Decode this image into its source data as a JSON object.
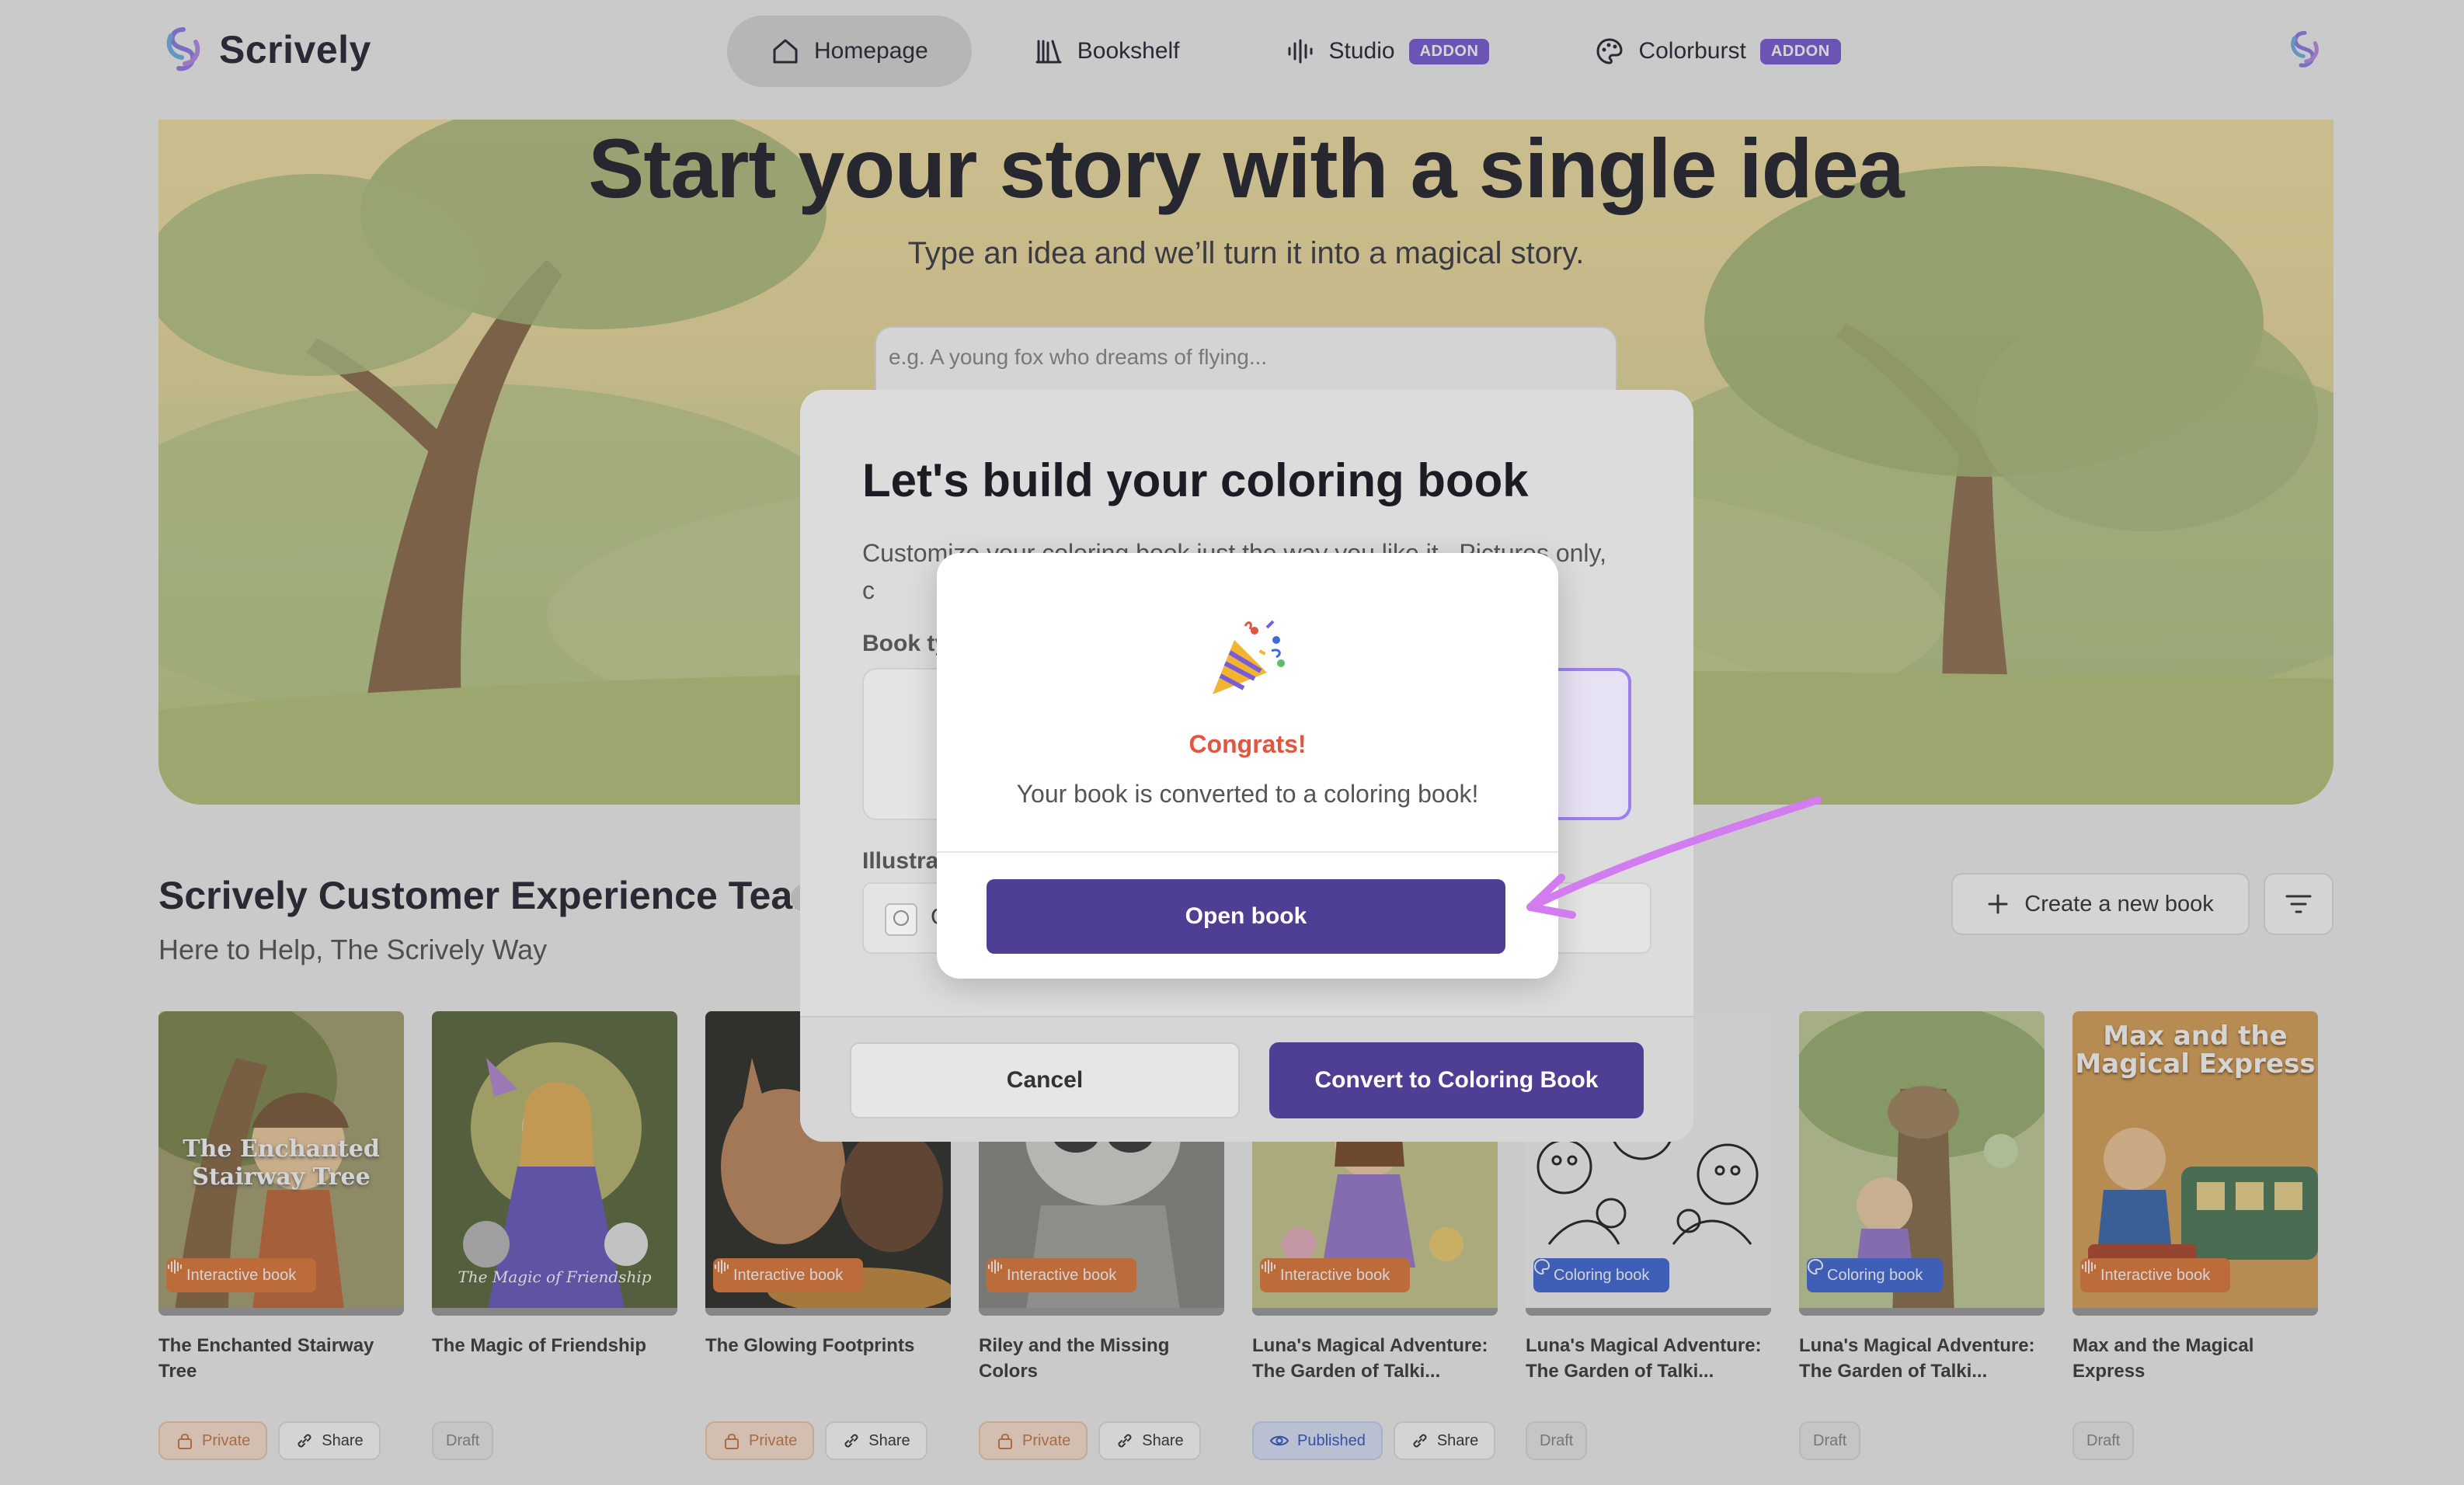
{
  "app": {
    "name": "Scrively"
  },
  "nav": {
    "items": [
      {
        "label": "Homepage",
        "icon": "home-icon",
        "active": true
      },
      {
        "label": "Bookshelf",
        "icon": "bookshelf-icon"
      },
      {
        "label": "Studio",
        "icon": "audio-wave-icon",
        "badge": "ADDON"
      },
      {
        "label": "Colorburst",
        "icon": "palette-icon",
        "badge": "ADDON"
      }
    ]
  },
  "hero": {
    "title": "Start your story with a single idea",
    "subtitle": "Type an idea and we’ll turn it into a magical story.",
    "input_placeholder": "e.g. A young fox who dreams of flying..."
  },
  "team": {
    "title": "Scrively Customer Experience Team",
    "subtitle": "Here to Help, The Scrively Way",
    "create_label": "Create a new book"
  },
  "books": [
    {
      "title": "The Enchanted Stairway Tree",
      "type": "Interactive book",
      "status": "Private",
      "share": "Share"
    },
    {
      "title": "The Magic of Friendship",
      "type": "",
      "status": "Draft"
    },
    {
      "title": "The Glowing Footprints",
      "type": "Interactive book",
      "status": "Private",
      "share": "Share"
    },
    {
      "title": "Riley and the Missing Colors",
      "type": "Interactive book",
      "status": "Private",
      "share": "Share"
    },
    {
      "title": "Luna's Magical Adventure: The Garden of Talki...",
      "type": "Interactive book",
      "status": "Published",
      "share": "Share"
    },
    {
      "title": "Luna's Magical Adventure: The Garden of Talki...",
      "type": "Coloring book",
      "status": "Draft"
    },
    {
      "title": "Luna's Magical Adventure: The Garden of Talki...",
      "type": "Coloring book",
      "status": "Draft"
    },
    {
      "title": "Max and the Magical Express",
      "type": "Interactive book",
      "status": "Draft",
      "cover_title": "Max and the Magical Express"
    }
  ],
  "cover_texts": {
    "b1": "The Enchanted Stairway Tree",
    "b2": "The Magic of Friendship"
  },
  "build_modal": {
    "title": "Let's build your coloring book",
    "description": "Customize your coloring book just the way you like it . Pictures only, c",
    "book_type_label": "Book ty",
    "illustration_label": "Illustrat",
    "illustration_value": "C",
    "cancel_label": "Cancel",
    "convert_label": "Convert to Coloring Book"
  },
  "congrats_modal": {
    "title": "Congrats!",
    "message": "Your book is converted to a coloring book!",
    "button_label": "Open book"
  },
  "colors": {
    "primary": "#4f3f94",
    "addon": "#7a5bd8",
    "congrats": "#e2553e",
    "interactive_badge": "#e07a3c",
    "coloring_badge": "#3f6ad8",
    "annotation_arrow": "#d27cf0"
  }
}
